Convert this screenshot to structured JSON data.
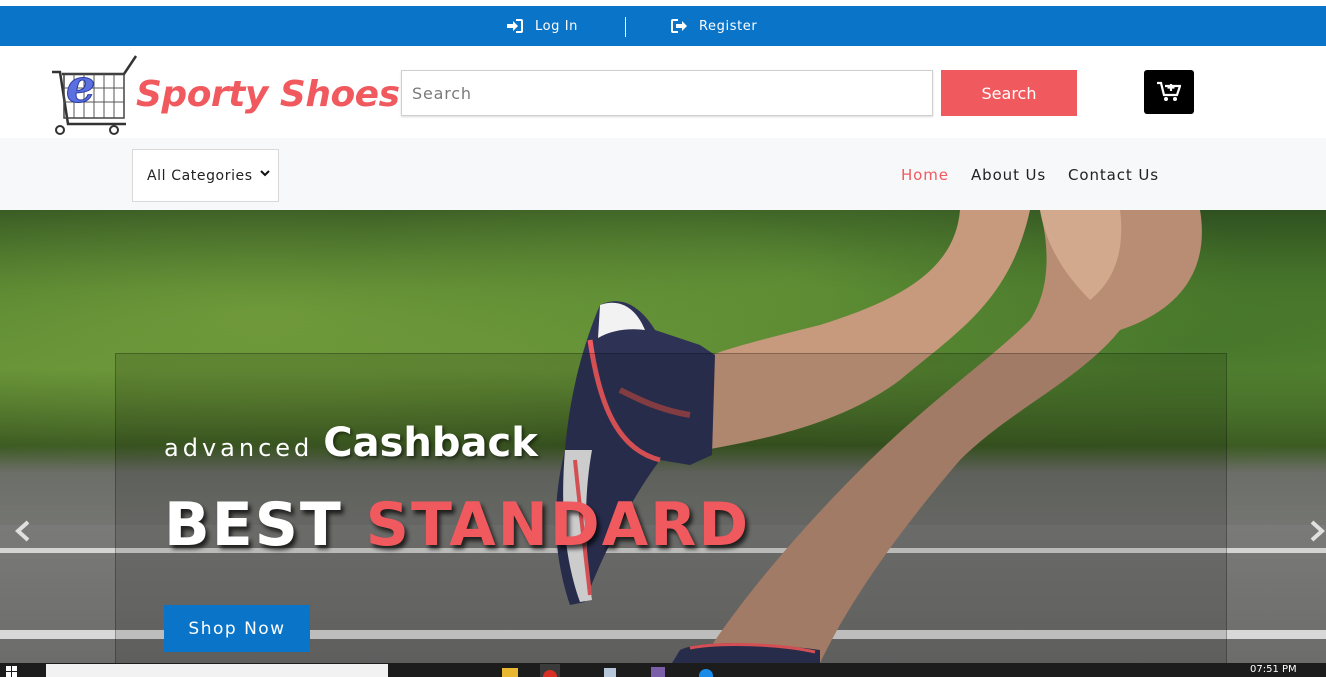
{
  "topbar": {
    "login_label": "Log In",
    "register_label": "Register",
    "login_icon": "sign-in-icon",
    "register_icon": "sign-out-icon"
  },
  "header": {
    "brand": "Sporty Shoes",
    "logo_letter": "e",
    "search_placeholder": "Search",
    "search_value": "",
    "search_button": "Search",
    "cart_icon": "cart-plus-icon"
  },
  "nav": {
    "category_selected": "All Categories",
    "links": [
      "Home",
      "About Us",
      "Contact Us"
    ],
    "active": "Home"
  },
  "hero": {
    "tagline_small": "advanced",
    "tagline_big": "Cashback",
    "headline_1": "BEST",
    "headline_2": "STANDARD",
    "cta": "Shop Now"
  },
  "taskbar": {
    "clock": "07:51 PM"
  },
  "colors": {
    "primary_blue": "#0a74c8",
    "accent_red": "#f05a5f",
    "navbar_bg": "#f7f8fa",
    "taskbar_bg": "#1c1c1c"
  }
}
